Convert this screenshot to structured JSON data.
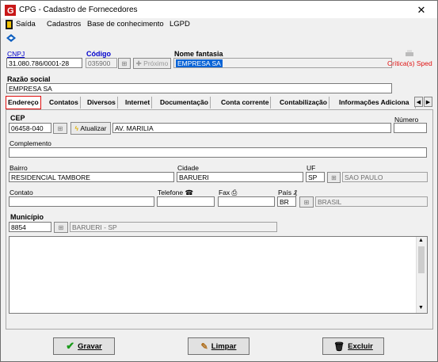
{
  "window": {
    "title": "CPG - Cadastro de Fornecedores",
    "close_glyph": "✕"
  },
  "menu": [
    {
      "label": "Saída"
    },
    {
      "label": "Cadastros"
    },
    {
      "label": "Base de conhecimento"
    },
    {
      "label": "LGPD"
    }
  ],
  "header": {
    "cnpj_label": "CNPJ",
    "cnpj_value": "31.080.786/0001-28",
    "codigo_label": "Código",
    "codigo_value": "035900",
    "proximo_label": "Próximo",
    "nome_fantasia_label": "Nome fantasia",
    "nome_fantasia_value": "EMPRESA SA",
    "critica_label": "Crítica(s) Sped",
    "razao_social_label": "Razão social",
    "razao_social_value": "EMPRESA SA"
  },
  "tabs": [
    {
      "label": "Endereço",
      "active": true
    },
    {
      "label": "Contatos"
    },
    {
      "label": "Diversos"
    },
    {
      "label": "Internet"
    },
    {
      "label": "Documentação"
    },
    {
      "label": "Conta corrente"
    },
    {
      "label": "Contabilização"
    },
    {
      "label": "Informações Adiciona"
    }
  ],
  "endereco": {
    "cep_label": "CEP",
    "cep_value": "06458-040",
    "atualizar_label": "Atualizar",
    "logradouro_value": "AV. MARILIA",
    "numero_label": "Número",
    "numero_value": "",
    "complemento_label": "Complemento",
    "complemento_value": "",
    "bairro_label": "Bairro",
    "bairro_value": "RESIDENCIAL TAMBORE",
    "cidade_label": "Cidade",
    "cidade_value": "BARUERI",
    "uf_label": "UF",
    "uf_value": "SP",
    "uf_name": "SAO PAULO",
    "contato_label": "Contato",
    "contato_value": "",
    "telefone_label": "Telefone",
    "telefone_value": "",
    "fax_label": "Fax",
    "fax_value": "",
    "pais_label": "País",
    "pais_code": "BR",
    "pais_name": "BRASIL",
    "municipio_label": "Município",
    "municipio_code": "8854",
    "municipio_name": "BARUERI - SP"
  },
  "footer": {
    "gravar_label": "Gravar",
    "limpar_label": "Limpar",
    "excluir_label": "Excluir"
  },
  "colors": {
    "accent_red": "#e01010",
    "selection": "#0a64d6",
    "link_blue": "#0000cc"
  }
}
